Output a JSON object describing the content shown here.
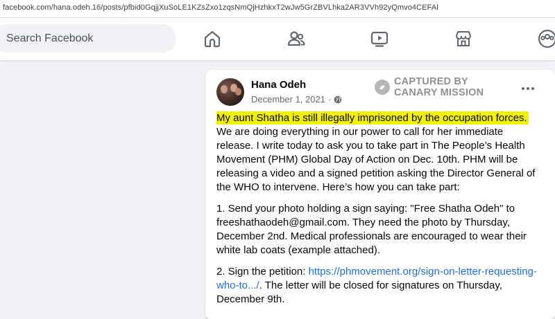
{
  "browser": {
    "url": "facebook.com/hana.odeh.16/posts/pfbid0GqjjXuSoLE1KZsZxo1zqsNmQjHzhkxT2wJw5GrZBVLhka2AR3VVh92yQmvo4CEFAl"
  },
  "navbar": {
    "search_placeholder": "Search Facebook",
    "icons": [
      "home-icon",
      "friends-icon",
      "watch-icon",
      "marketplace-icon",
      "groups-icon"
    ]
  },
  "post": {
    "author": "Hana Odeh",
    "date": "December 1, 2021",
    "date_separator": "·",
    "privacy_icon": "globe-icon",
    "watermark": {
      "line1": "CAPTURED BY",
      "line2": "CANARY MISSION"
    },
    "highlight_text": "My aunt Shatha is still illegally imprisoned by the occupation forces.",
    "para1_rest": " We are doing everything in our power to call for her immediate release. I write today to ask you to take part in The People’s Health Movement (PHM) Global Day of Action on Dec. 10th. PHM will be releasing a video and a signed petition asking the Director General of the WHO to intervene. Here’s how you can take part:",
    "para2": "1. Send your photo holding a sign saying: \"Free Shatha Odeh\" to freeshathaodeh@gmail.com. They need the photo by Thursday, December 2nd. Medical professionals are encouraged to wear their white lab coats (example attached).",
    "para3_prefix": "2. Sign the petition: ",
    "para3_link": "https://phmovement.org/sign-on-letter-requesting-who-to.../",
    "para3_suffix": ". The letter will be closed for signatures on Thursday, December 9th."
  },
  "colors": {
    "highlight": "#f2f200",
    "link": "#216fdb",
    "icon": "#606770"
  }
}
